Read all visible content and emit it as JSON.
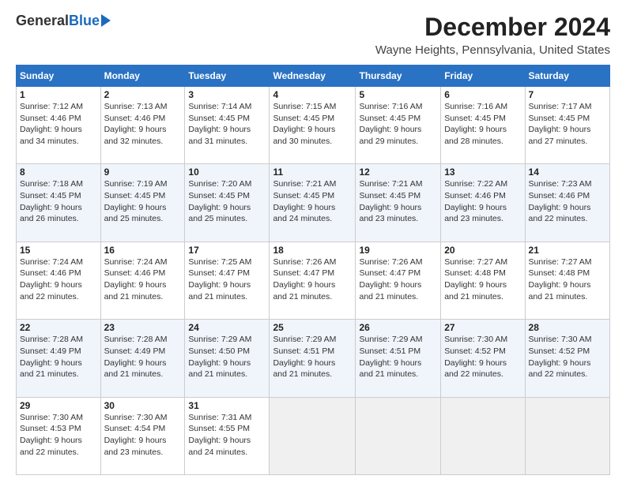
{
  "logo": {
    "general": "General",
    "blue": "Blue"
  },
  "title": "December 2024",
  "subtitle": "Wayne Heights, Pennsylvania, United States",
  "days_of_week": [
    "Sunday",
    "Monday",
    "Tuesday",
    "Wednesday",
    "Thursday",
    "Friday",
    "Saturday"
  ],
  "weeks": [
    [
      {
        "day": "1",
        "info": "Sunrise: 7:12 AM\nSunset: 4:46 PM\nDaylight: 9 hours\nand 34 minutes."
      },
      {
        "day": "2",
        "info": "Sunrise: 7:13 AM\nSunset: 4:46 PM\nDaylight: 9 hours\nand 32 minutes."
      },
      {
        "day": "3",
        "info": "Sunrise: 7:14 AM\nSunset: 4:45 PM\nDaylight: 9 hours\nand 31 minutes."
      },
      {
        "day": "4",
        "info": "Sunrise: 7:15 AM\nSunset: 4:45 PM\nDaylight: 9 hours\nand 30 minutes."
      },
      {
        "day": "5",
        "info": "Sunrise: 7:16 AM\nSunset: 4:45 PM\nDaylight: 9 hours\nand 29 minutes."
      },
      {
        "day": "6",
        "info": "Sunrise: 7:16 AM\nSunset: 4:45 PM\nDaylight: 9 hours\nand 28 minutes."
      },
      {
        "day": "7",
        "info": "Sunrise: 7:17 AM\nSunset: 4:45 PM\nDaylight: 9 hours\nand 27 minutes."
      }
    ],
    [
      {
        "day": "8",
        "info": "Sunrise: 7:18 AM\nSunset: 4:45 PM\nDaylight: 9 hours\nand 26 minutes."
      },
      {
        "day": "9",
        "info": "Sunrise: 7:19 AM\nSunset: 4:45 PM\nDaylight: 9 hours\nand 25 minutes."
      },
      {
        "day": "10",
        "info": "Sunrise: 7:20 AM\nSunset: 4:45 PM\nDaylight: 9 hours\nand 25 minutes."
      },
      {
        "day": "11",
        "info": "Sunrise: 7:21 AM\nSunset: 4:45 PM\nDaylight: 9 hours\nand 24 minutes."
      },
      {
        "day": "12",
        "info": "Sunrise: 7:21 AM\nSunset: 4:45 PM\nDaylight: 9 hours\nand 23 minutes."
      },
      {
        "day": "13",
        "info": "Sunrise: 7:22 AM\nSunset: 4:46 PM\nDaylight: 9 hours\nand 23 minutes."
      },
      {
        "day": "14",
        "info": "Sunrise: 7:23 AM\nSunset: 4:46 PM\nDaylight: 9 hours\nand 22 minutes."
      }
    ],
    [
      {
        "day": "15",
        "info": "Sunrise: 7:24 AM\nSunset: 4:46 PM\nDaylight: 9 hours\nand 22 minutes."
      },
      {
        "day": "16",
        "info": "Sunrise: 7:24 AM\nSunset: 4:46 PM\nDaylight: 9 hours\nand 21 minutes."
      },
      {
        "day": "17",
        "info": "Sunrise: 7:25 AM\nSunset: 4:47 PM\nDaylight: 9 hours\nand 21 minutes."
      },
      {
        "day": "18",
        "info": "Sunrise: 7:26 AM\nSunset: 4:47 PM\nDaylight: 9 hours\nand 21 minutes."
      },
      {
        "day": "19",
        "info": "Sunrise: 7:26 AM\nSunset: 4:47 PM\nDaylight: 9 hours\nand 21 minutes."
      },
      {
        "day": "20",
        "info": "Sunrise: 7:27 AM\nSunset: 4:48 PM\nDaylight: 9 hours\nand 21 minutes."
      },
      {
        "day": "21",
        "info": "Sunrise: 7:27 AM\nSunset: 4:48 PM\nDaylight: 9 hours\nand 21 minutes."
      }
    ],
    [
      {
        "day": "22",
        "info": "Sunrise: 7:28 AM\nSunset: 4:49 PM\nDaylight: 9 hours\nand 21 minutes."
      },
      {
        "day": "23",
        "info": "Sunrise: 7:28 AM\nSunset: 4:49 PM\nDaylight: 9 hours\nand 21 minutes."
      },
      {
        "day": "24",
        "info": "Sunrise: 7:29 AM\nSunset: 4:50 PM\nDaylight: 9 hours\nand 21 minutes."
      },
      {
        "day": "25",
        "info": "Sunrise: 7:29 AM\nSunset: 4:51 PM\nDaylight: 9 hours\nand 21 minutes."
      },
      {
        "day": "26",
        "info": "Sunrise: 7:29 AM\nSunset: 4:51 PM\nDaylight: 9 hours\nand 21 minutes."
      },
      {
        "day": "27",
        "info": "Sunrise: 7:30 AM\nSunset: 4:52 PM\nDaylight: 9 hours\nand 22 minutes."
      },
      {
        "day": "28",
        "info": "Sunrise: 7:30 AM\nSunset: 4:52 PM\nDaylight: 9 hours\nand 22 minutes."
      }
    ],
    [
      {
        "day": "29",
        "info": "Sunrise: 7:30 AM\nSunset: 4:53 PM\nDaylight: 9 hours\nand 22 minutes."
      },
      {
        "day": "30",
        "info": "Sunrise: 7:30 AM\nSunset: 4:54 PM\nDaylight: 9 hours\nand 23 minutes."
      },
      {
        "day": "31",
        "info": "Sunrise: 7:31 AM\nSunset: 4:55 PM\nDaylight: 9 hours\nand 24 minutes."
      },
      {
        "day": "",
        "info": ""
      },
      {
        "day": "",
        "info": ""
      },
      {
        "day": "",
        "info": ""
      },
      {
        "day": "",
        "info": ""
      }
    ]
  ]
}
